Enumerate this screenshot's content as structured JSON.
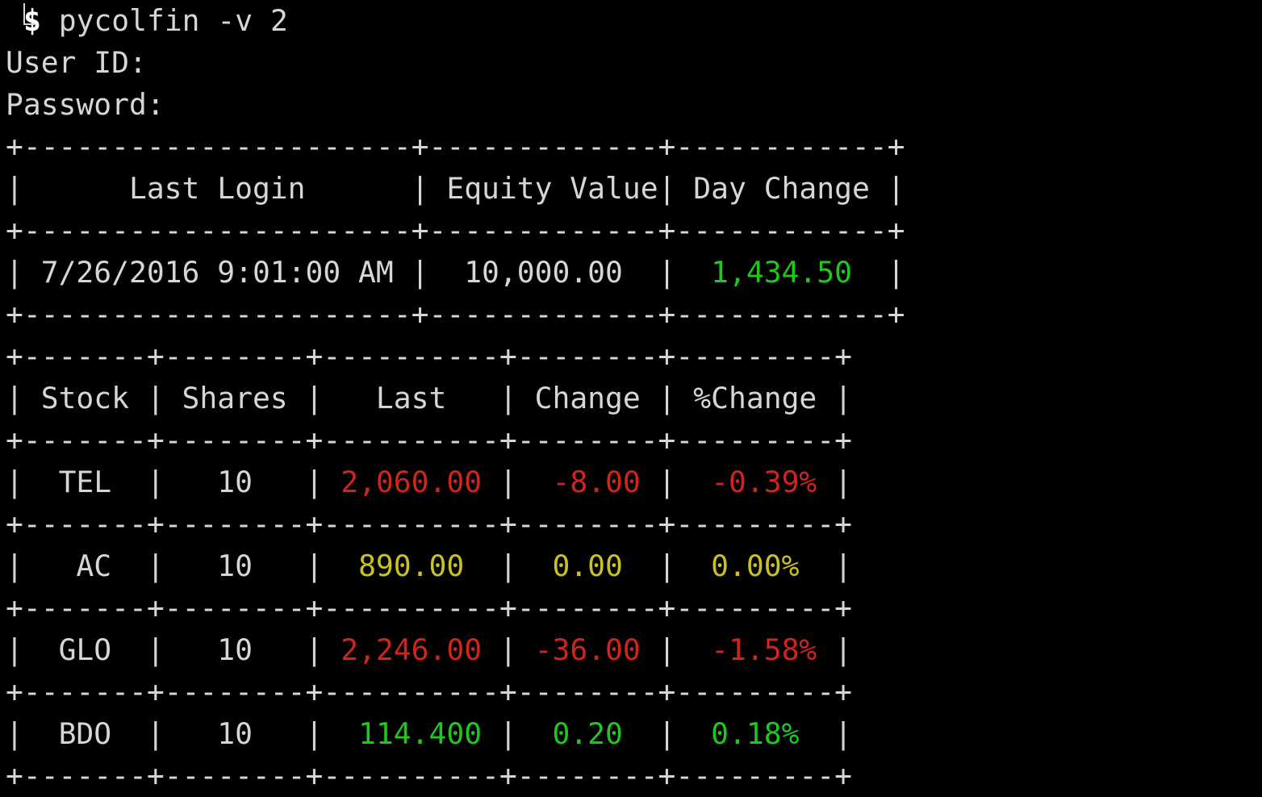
{
  "terminal": {
    "prompt_sigil": "$",
    "command": "pycolfin -v 2",
    "user_id_label": "User ID:",
    "password_label": "Password:"
  },
  "summary_table": {
    "headers": [
      "Last Login",
      "Equity Value",
      "Day Change"
    ],
    "row": {
      "last_login": "7/26/2016 9:01:00 AM",
      "equity_value": "10,000.00",
      "day_change": "1,434.50",
      "day_change_color": "#1fc71f"
    }
  },
  "stocks_table": {
    "headers": [
      "Stock",
      "Shares",
      "Last",
      "Change",
      "%Change"
    ],
    "rows": [
      {
        "stock": "TEL",
        "shares": "10",
        "last": "2,060.00",
        "change": "-8.00",
        "pct_change": "-0.39%",
        "status": "down"
      },
      {
        "stock": "AC",
        "shares": "10",
        "last": "890.00",
        "change": "0.00",
        "pct_change": "0.00%",
        "status": "flat"
      },
      {
        "stock": "GLO",
        "shares": "10",
        "last": "2,246.00",
        "change": "-36.00",
        "pct_change": "-1.58%",
        "status": "down"
      },
      {
        "stock": "BDO",
        "shares": "10",
        "last": "114.400",
        "change": "0.20",
        "pct_change": "0.18%",
        "status": "up"
      }
    ]
  },
  "colors": {
    "background": "#000000",
    "text": "#d6d6d6",
    "down": "#d2231c",
    "up": "#1fc71f",
    "flat": "#c9c224"
  }
}
